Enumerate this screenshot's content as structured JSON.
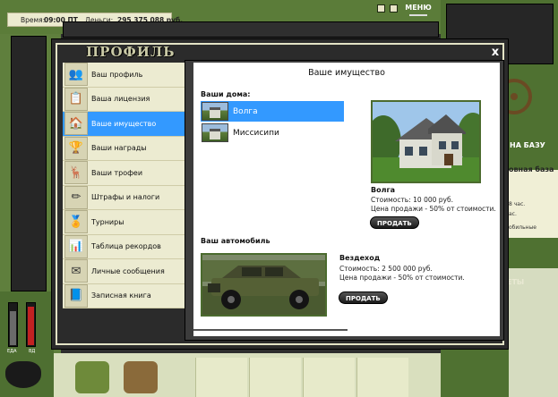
{
  "topbar": {
    "time_label": "Время:",
    "time_value": "09:00 ПТ",
    "money_label": "Деньги:",
    "money_value": "295 375 088 руб.",
    "menu_label": "МЕНЮ"
  },
  "background": {
    "right_button": "НА БАЗУ",
    "right_text": "овная база",
    "right_small_1": "8 час.",
    "right_small_2": "ас.",
    "right_small_3": "обильные",
    "right_bottom": "ЕТЫ",
    "gauge_1_label": "ЕДА",
    "gauge_2_label": "ВД",
    "gauge_1_level": 0.8,
    "gauge_2_level": 0.9
  },
  "profile": {
    "title": "ПРОФИЛЬ",
    "close": "x",
    "nav": [
      {
        "label": "Ваш профиль",
        "icon": "👥"
      },
      {
        "label": "Ваша лицензия",
        "icon": "📋"
      },
      {
        "label": "Ваше имущество",
        "icon": "🏠"
      },
      {
        "label": "Ваши награды",
        "icon": "🏆"
      },
      {
        "label": "Ваши трофеи",
        "icon": "🦌"
      },
      {
        "label": "Штрафы и налоги",
        "icon": "✏"
      },
      {
        "label": "Турниры",
        "icon": "🏅"
      },
      {
        "label": "Таблица рекордов",
        "icon": "📊"
      },
      {
        "label": "Личные сообщения",
        "icon": "✉"
      },
      {
        "label": "Записная книга",
        "icon": "📘"
      }
    ],
    "active_nav_index": 2
  },
  "property": {
    "title": "Ваше имущество",
    "houses_heading": "Ваши дома:",
    "houses": [
      {
        "name": "Волга"
      },
      {
        "name": "Миссисипи"
      }
    ],
    "selected_house_index": 0,
    "house_info": {
      "name": "Волга",
      "cost": "Стоимость: 10 000 руб.",
      "sale_price": "Цена продажи - 50% от стоимости.",
      "sell_label": "ПРОДАТЬ"
    },
    "car_heading": "Ваш автомобиль",
    "car_info": {
      "name": "Вездеход",
      "cost": "Стоимость: 2 500 000 руб.",
      "sale_price": "Цена продажи - 50% от стоимости.",
      "sell_label": "ПРОДАТЬ"
    }
  }
}
